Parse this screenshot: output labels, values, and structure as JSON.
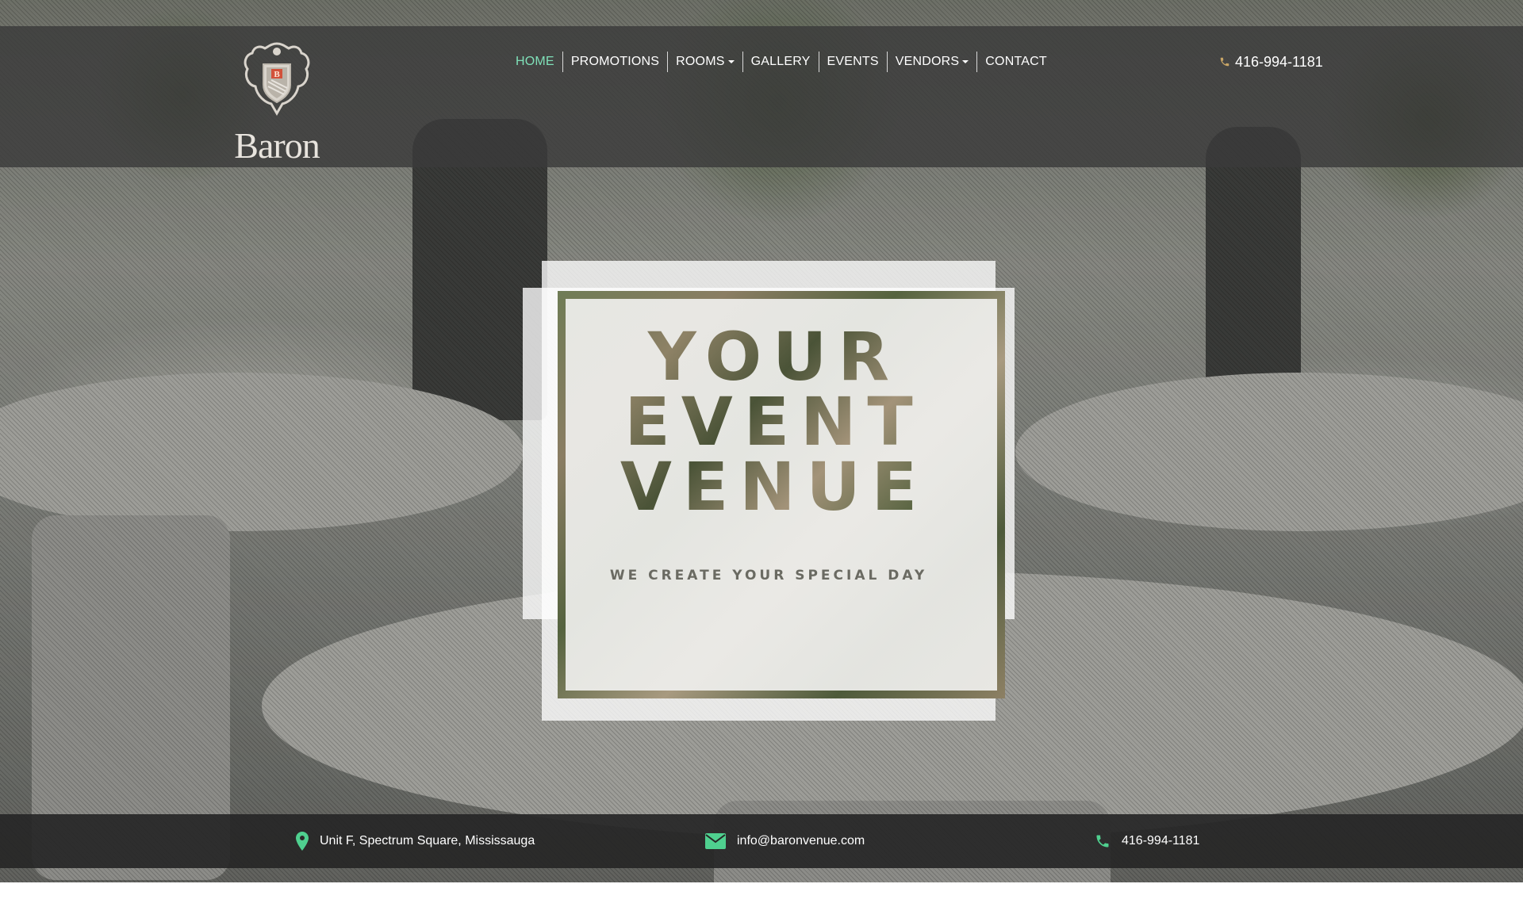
{
  "brand": {
    "logo_text": "Baron",
    "crest_letter": "B"
  },
  "nav": {
    "items": [
      {
        "label": "HOME",
        "active": true,
        "has_dropdown": false
      },
      {
        "label": "PROMOTIONS",
        "active": false,
        "has_dropdown": false
      },
      {
        "label": "ROOMS",
        "active": false,
        "has_dropdown": true
      },
      {
        "label": "GALLERY",
        "active": false,
        "has_dropdown": false
      },
      {
        "label": "EVENTS",
        "active": false,
        "has_dropdown": false
      },
      {
        "label": "VENDORS",
        "active": false,
        "has_dropdown": true
      },
      {
        "label": "CONTACT",
        "active": false,
        "has_dropdown": false
      }
    ]
  },
  "header": {
    "phone": "416-994-1181",
    "phone_icon": "phone-icon"
  },
  "hero": {
    "headline_lines": [
      "YOUR",
      "EVENT",
      "VENUE"
    ],
    "tagline": "WE CREATE YOUR SPECIAL DAY"
  },
  "info_bar": {
    "address": {
      "icon": "map-marker-icon",
      "text": "Unit F, Spectrum Square, Mississauga"
    },
    "email": {
      "icon": "envelope-icon",
      "text": "info@baronvenue.com"
    },
    "phone": {
      "icon": "phone-icon",
      "text": "416-994-1181"
    }
  },
  "colors": {
    "accent": "#7fe0b8",
    "icon_green": "#4fd08f",
    "header_bg": "#3a3a3a",
    "info_bar_bg": "#262626",
    "crest_red": "#d2513a"
  }
}
